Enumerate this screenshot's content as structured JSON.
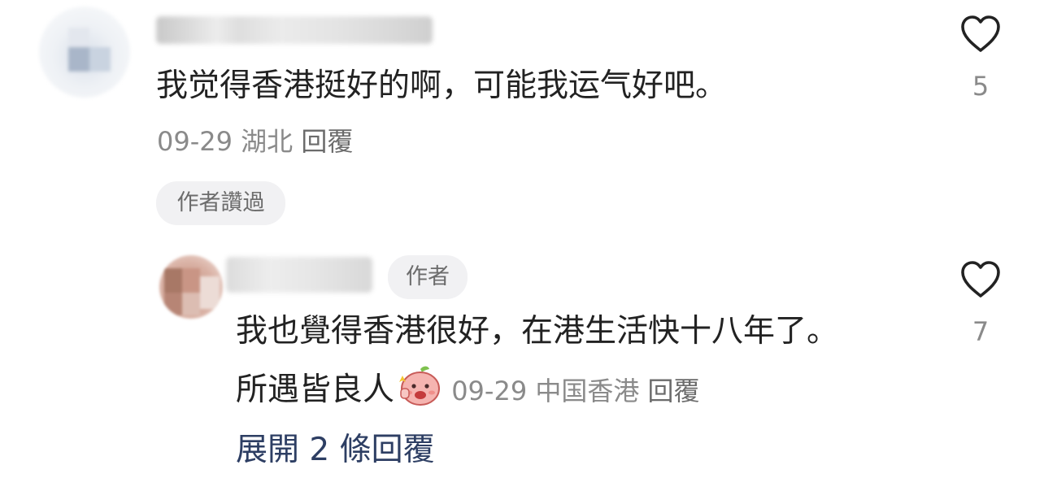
{
  "comment": {
    "text": "我觉得香港挺好的啊，可能我运气好吧。",
    "date": "09-29",
    "location": "湖北",
    "reply_label": "回覆",
    "author_liked_badge": "作者讚過",
    "like_count": "5"
  },
  "reply": {
    "author_badge": "作者",
    "text_line1": "我也覺得香港很好，在港生活快十八年了。",
    "text_line2": "所遇皆良人",
    "emoji_icon": "thumbs-up-peach-emoji",
    "date": "09-29",
    "location": "中国香港",
    "reply_label": "回覆",
    "like_count": "7"
  },
  "expand_replies_label": "展開 2 條回覆",
  "colors": {
    "text_primary": "#222222",
    "text_secondary": "#8a8a8a",
    "badge_bg": "#f1f1f3",
    "link_blue": "#2d3e63",
    "heart_stroke": "#222222"
  }
}
